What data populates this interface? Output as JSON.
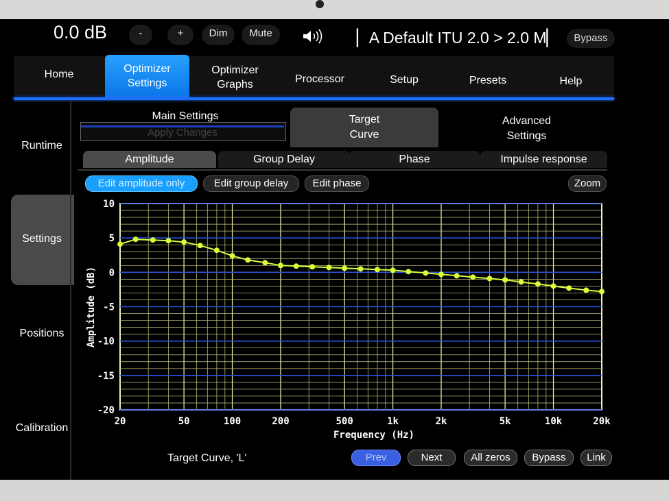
{
  "topbar": {
    "volume": "0.0 dB",
    "minus": "-",
    "plus": "+",
    "dim": "Dim",
    "mute": "Mute",
    "speaker_icon": "speaker-icon",
    "preset": "▏A Default ITU 2.0 > 2.0  M▏",
    "bypass": "Bypass"
  },
  "nav": {
    "items": [
      {
        "label": "Home"
      },
      {
        "label": "Optimizer\nSettings",
        "active": true
      },
      {
        "label": "Optimizer\nGraphs"
      },
      {
        "label": "Processor"
      },
      {
        "label": "Setup"
      },
      {
        "label": "Presets"
      },
      {
        "label": "Help"
      }
    ]
  },
  "side": {
    "items": [
      {
        "label": "Runtime"
      },
      {
        "label": "Settings",
        "active": true
      },
      {
        "label": "Positions"
      },
      {
        "label": "Calibration"
      }
    ]
  },
  "subtabs": {
    "main": "Main Settings",
    "apply": "Apply Changes",
    "target": "Target\nCurve",
    "advanced": "Advanced\nSettings"
  },
  "tabs": {
    "amplitude": "Amplitude",
    "group_delay": "Group Delay",
    "phase": "Phase",
    "impulse": "Impulse response"
  },
  "edit": {
    "amplitude": "Edit amplitude only",
    "group_delay": "Edit group delay",
    "phase": "Edit phase",
    "zoom": "Zoom"
  },
  "bottom": {
    "curve_label": "Target Curve, 'L'",
    "prev": "Prev",
    "next": "Next",
    "all_zeros": "All zeros",
    "bypass": "Bypass",
    "link": "Link"
  },
  "colors": {
    "accent": "#1a8cff",
    "curve": "#d8ff3a",
    "major_grid": "#e9e9a0",
    "blue_grid": "#2b55d8"
  },
  "chart_data": {
    "type": "line",
    "xlabel": "Frequency (Hz)",
    "ylabel": "Amplitude (dB)",
    "xscale": "log",
    "xlim": [
      20,
      20000
    ],
    "ylim": [
      -20,
      10
    ],
    "xticks": [
      20,
      50,
      100,
      200,
      500,
      1000,
      2000,
      5000,
      10000,
      20000
    ],
    "xtick_labels": [
      "20",
      "50",
      "100",
      "200",
      "500",
      "1k",
      "2k",
      "5k",
      "10k",
      "20k"
    ],
    "yticks": [
      10,
      5,
      0,
      -5,
      -10,
      -15,
      -20
    ],
    "ytick_labels": [
      "10",
      "5",
      "0",
      "-5",
      "-10",
      "-15",
      "-20"
    ],
    "grid": true,
    "series": [
      {
        "x": [
          20,
          25,
          32,
          40,
          50,
          63,
          80,
          100,
          125,
          160,
          200,
          250,
          315,
          400,
          500,
          630,
          800,
          1000,
          1250,
          1600,
          2000,
          2500,
          3150,
          4000,
          5000,
          6300,
          8000,
          10000,
          12500,
          16000,
          20000
        ],
        "y": [
          4.1,
          4.8,
          4.7,
          4.6,
          4.4,
          3.9,
          3.2,
          2.4,
          1.8,
          1.4,
          1.0,
          0.9,
          0.8,
          0.7,
          0.6,
          0.5,
          0.4,
          0.3,
          0.1,
          -0.1,
          -0.3,
          -0.5,
          -0.7,
          -0.9,
          -1.1,
          -1.4,
          -1.7,
          -2.0,
          -2.3,
          -2.6,
          -2.8
        ]
      }
    ]
  }
}
